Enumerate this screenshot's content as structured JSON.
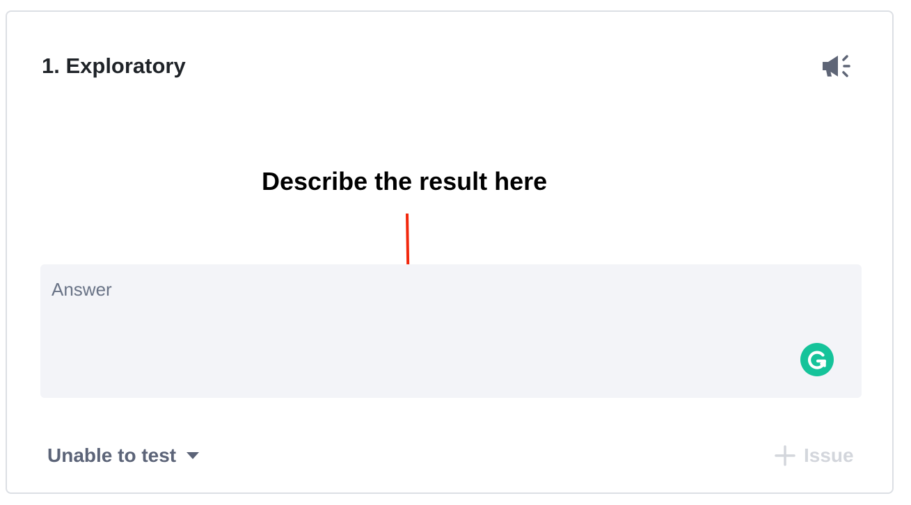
{
  "card": {
    "title": "1. Exploratory",
    "announce_icon": "megaphone-icon"
  },
  "annotation": {
    "text": "Describe the result here",
    "arrow_color": "#f2270c"
  },
  "answer": {
    "placeholder": "Answer",
    "value": "",
    "assistant_icon": "grammarly-icon",
    "assistant_color": "#15c39a"
  },
  "footer": {
    "status_label": "Unable to test",
    "status_icon": "caret-down-icon",
    "issue_label": "Issue",
    "issue_icon": "plus-icon"
  }
}
